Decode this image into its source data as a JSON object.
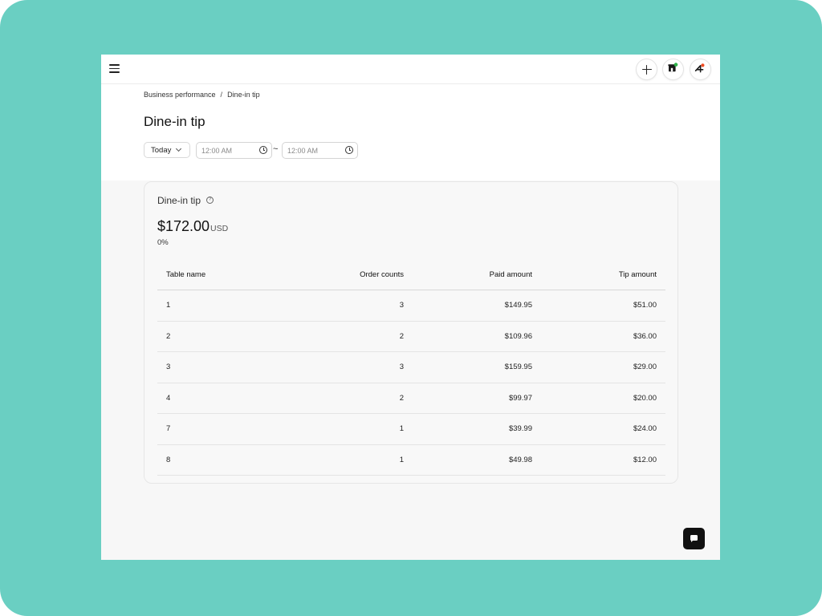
{
  "toolbar": {
    "menu_icon": "hamburger-menu-icon",
    "add_icon": "plus-icon",
    "store_icon": "store-icon",
    "assistant_icon": "assistant-icon",
    "colors": {
      "store_dot": "#2fb34a",
      "assistant_dot": "#f04d23"
    }
  },
  "breadcrumb": {
    "items": [
      {
        "label": "Business performance"
      },
      {
        "label": "Dine-in tip"
      }
    ],
    "separator": "/"
  },
  "page": {
    "title": "Dine-in tip"
  },
  "filters": {
    "period": {
      "selected": "Today"
    },
    "time_from": {
      "placeholder": "12:00 AM"
    },
    "time_to": {
      "placeholder": "12:00 AM"
    },
    "range_separator": "~"
  },
  "card": {
    "title": "Dine-in tip",
    "help_icon": "question-circle-icon",
    "total_amount": "$172.00",
    "currency": "USD",
    "change": "0%"
  },
  "table": {
    "columns": [
      "Table name",
      "Order counts",
      "Paid amount",
      "Tip amount"
    ],
    "rows": [
      [
        "1",
        "3",
        "$149.95",
        "$51.00"
      ],
      [
        "2",
        "2",
        "$109.96",
        "$36.00"
      ],
      [
        "3",
        "3",
        "$159.95",
        "$29.00"
      ],
      [
        "4",
        "2",
        "$99.97",
        "$20.00"
      ],
      [
        "7",
        "1",
        "$39.99",
        "$24.00"
      ],
      [
        "8",
        "1",
        "$49.98",
        "$12.00"
      ]
    ]
  },
  "chat": {
    "icon": "chat-icon"
  },
  "theme": {
    "frame_background": "#6acfc2",
    "accent": "#111111"
  }
}
